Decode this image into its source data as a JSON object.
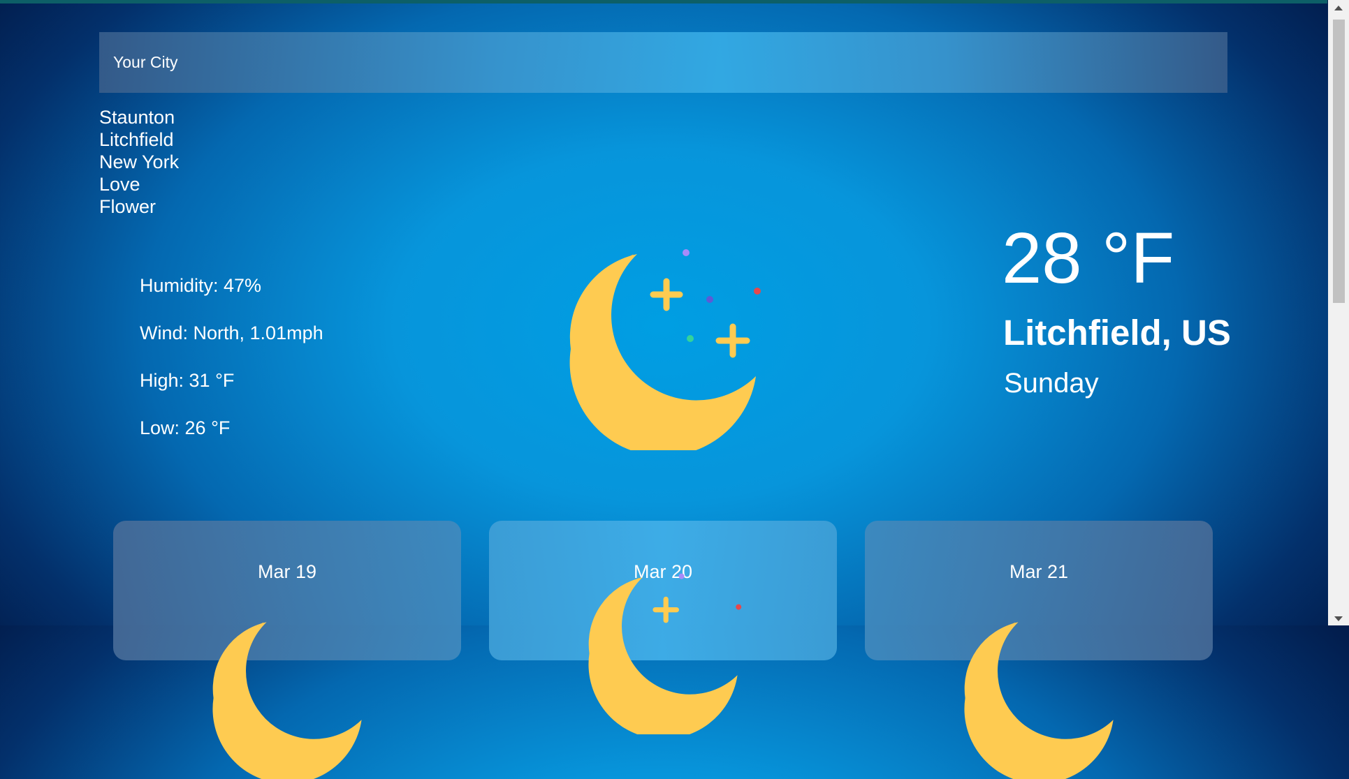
{
  "search": {
    "placeholder": "Your City"
  },
  "cities": [
    "Staunton",
    "Litchfield",
    "New York",
    "Love",
    "Flower"
  ],
  "details": {
    "humidity": "Humidity: 47%",
    "wind": "Wind: North, 1.01mph",
    "high": "High: 31 °F",
    "low": "Low: 26 °F"
  },
  "current": {
    "temperature": "28 °F",
    "location": "Litchfield, US",
    "day": "Sunday",
    "icon": "crescent-moon-stars-icon"
  },
  "forecast": [
    {
      "date": "Mar 19",
      "icon": "crescent-moon-stars-icon"
    },
    {
      "date": "Mar 20",
      "icon": "crescent-moon-stars-icon"
    },
    {
      "date": "Mar 21",
      "icon": "crescent-moon-stars-icon"
    }
  ],
  "colors": {
    "moon": "#fecb51",
    "moon_shade": "#f4b33c",
    "sky_center": "#009ee3",
    "sky_edge": "#021d4d"
  }
}
